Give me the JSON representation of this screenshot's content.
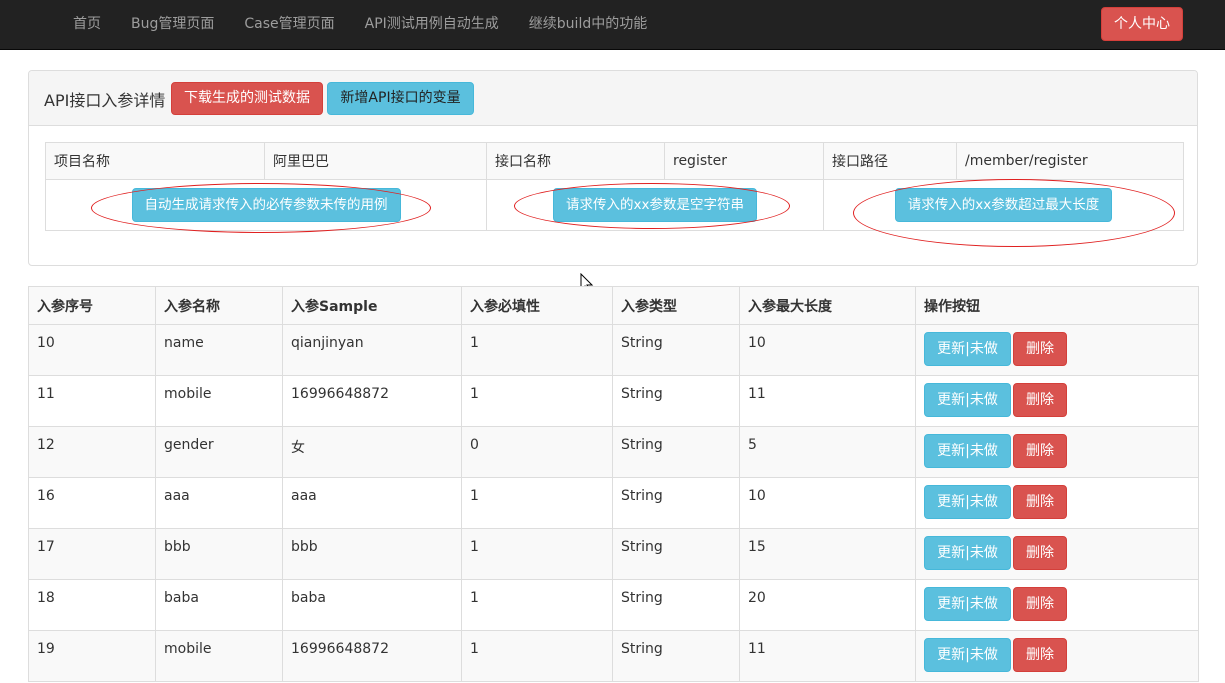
{
  "nav": {
    "items": [
      "首页",
      "Bug管理页面",
      "Case管理页面",
      "API测试用例自动生成",
      "继续build中的功能"
    ],
    "user_center": "个人中心"
  },
  "panel": {
    "title": "API接口入参详情",
    "download_label": "下载生成的测试数据",
    "add_variable_label": "新增API接口的变量"
  },
  "api_info": {
    "project_label": "项目名称",
    "project_value": "阿里巴巴",
    "interface_label": "接口名称",
    "interface_value": "register",
    "path_label": "接口路径",
    "path_value": "/member/register",
    "gen_required_missing": "自动生成请求传入的必传参数未传的用例",
    "gen_empty_string": "请求传入的xx参数是空字符串",
    "gen_exceed_length": "请求传入的xx参数超过最大长度"
  },
  "params_table": {
    "headers": [
      "入参序号",
      "入参名称",
      "入参Sample",
      "入参必填性",
      "入参类型",
      "入参最大长度",
      "操作按钮"
    ],
    "update_label": "更新|未做",
    "delete_label": "删除",
    "rows": [
      {
        "id": "10",
        "name": "name",
        "sample": "qianjinyan",
        "required": "1",
        "type": "String",
        "max_length": "10"
      },
      {
        "id": "11",
        "name": "mobile",
        "sample": "16996648872",
        "required": "1",
        "type": "String",
        "max_length": "11"
      },
      {
        "id": "12",
        "name": "gender",
        "sample": "女",
        "required": "0",
        "type": "String",
        "max_length": "5"
      },
      {
        "id": "16",
        "name": "aaa",
        "sample": "aaa",
        "required": "1",
        "type": "String",
        "max_length": "10"
      },
      {
        "id": "17",
        "name": "bbb",
        "sample": "bbb",
        "required": "1",
        "type": "String",
        "max_length": "15"
      },
      {
        "id": "18",
        "name": "baba",
        "sample": "baba",
        "required": "1",
        "type": "String",
        "max_length": "20"
      },
      {
        "id": "19",
        "name": "mobile",
        "sample": "16996648872",
        "required": "1",
        "type": "String",
        "max_length": "11"
      }
    ]
  },
  "colors": {
    "navbar_bg": "#222222",
    "danger": "#d9534f",
    "info": "#5bc0de",
    "annotation_ellipse": "#e02020"
  },
  "icons": {
    "cursor": "mouse-pointer-icon"
  }
}
